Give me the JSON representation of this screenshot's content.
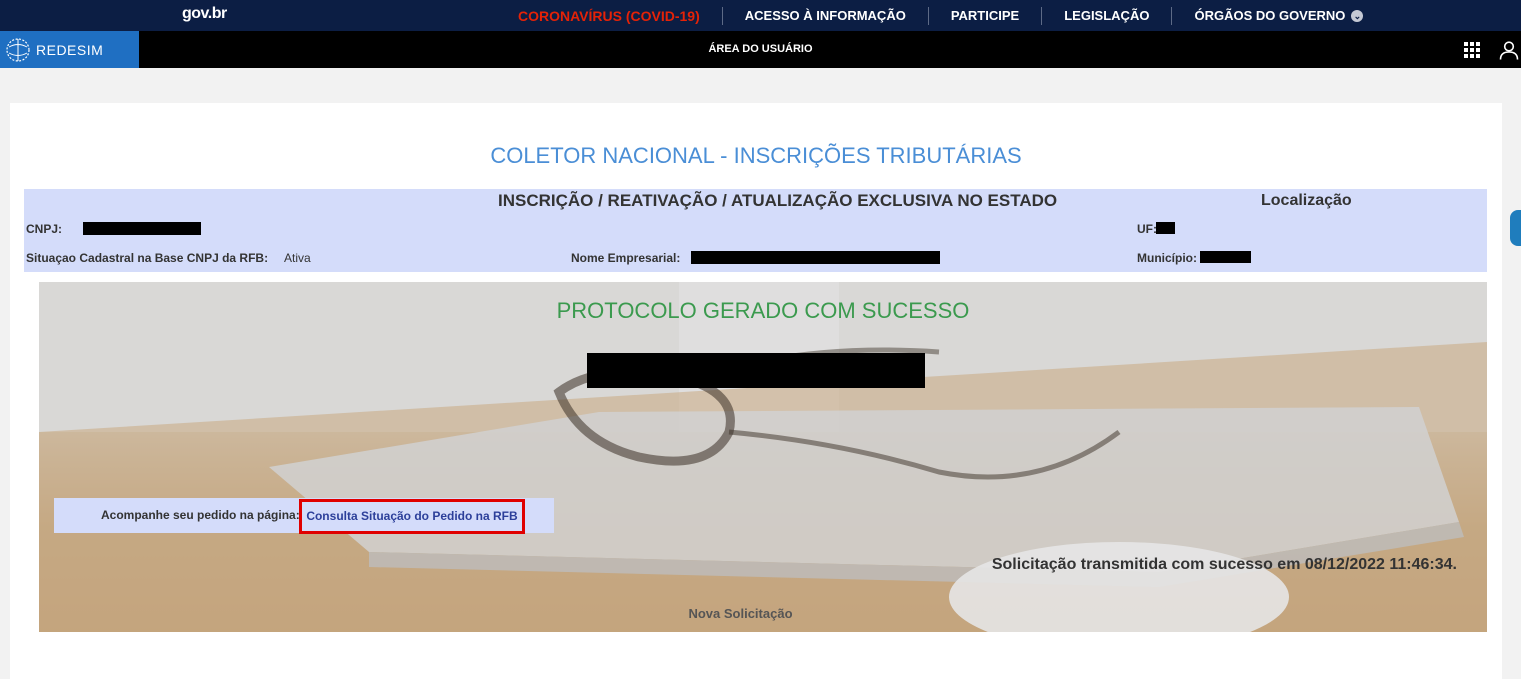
{
  "govbar": {
    "logo": "gov.br",
    "nav": [
      "CORONAVÍRUS (COVID-19)",
      "ACESSO À INFORMAÇÃO",
      "PARTICIPE",
      "LEGISLAÇÃO",
      "ÓRGÃOS DO GOVERNO"
    ]
  },
  "redesim": {
    "logo_text": "REDESIM",
    "area_label": "ÁREA DO USUÁRIO"
  },
  "page": {
    "title": "COLETOR NACIONAL - INSCRIÇÕES TRIBUTÁRIAS"
  },
  "info": {
    "heading": "INSCRIÇÃO / REATIVAÇÃO / ATUALIZAÇÃO EXCLUSIVA NO ESTADO",
    "location_heading": "Localização",
    "cnpj_label": "CNPJ:",
    "uf_label": "UF:",
    "situacao_label": "Situaçao Cadastral na Base CNPJ da RFB:",
    "situacao_value": "Ativa",
    "nome_label": "Nome Empresarial:",
    "municipio_label": "Município:"
  },
  "protocol": {
    "title": "PROTOCOLO GERADO COM SUCESSO",
    "follow_label": "Acompanhe seu pedido na página:",
    "follow_link": "Consulta Situação do Pedido na RFB",
    "success_message": "Solicitação transmitida com sucesso em 08/12/2022 11:46:34.",
    "new_request": "Nova Solicitação"
  },
  "colors": {
    "govbar_bg": "#0c1e44",
    "covid_red": "#e52207",
    "redesim_blue": "#1f6fc2",
    "title_blue": "#4a8ed6",
    "info_bg": "#d4dcfa",
    "success_green": "#3b9a4e",
    "highlight_red": "#e00000"
  }
}
